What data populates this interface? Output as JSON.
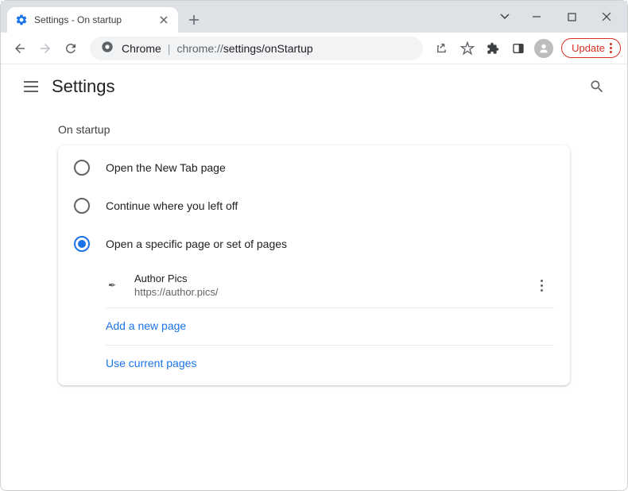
{
  "tab": {
    "title": "Settings - On startup"
  },
  "omnibox": {
    "prefix": "Chrome",
    "url_host": "chrome://",
    "url_path": "settings/onStartup"
  },
  "update_button": {
    "label": "Update"
  },
  "header": {
    "title": "Settings"
  },
  "section": {
    "title": "On startup"
  },
  "options": {
    "new_tab": "Open the New Tab page",
    "continue": "Continue where you left off",
    "specific": "Open a specific page or set of pages"
  },
  "pages": [
    {
      "name": "Author Pics",
      "url": "https://author.pics/"
    }
  ],
  "links": {
    "add_page": "Add a new page",
    "use_current": "Use current pages"
  },
  "selected_option": "specific",
  "colors": {
    "accent": "#1a73e8",
    "danger": "#d93025"
  }
}
